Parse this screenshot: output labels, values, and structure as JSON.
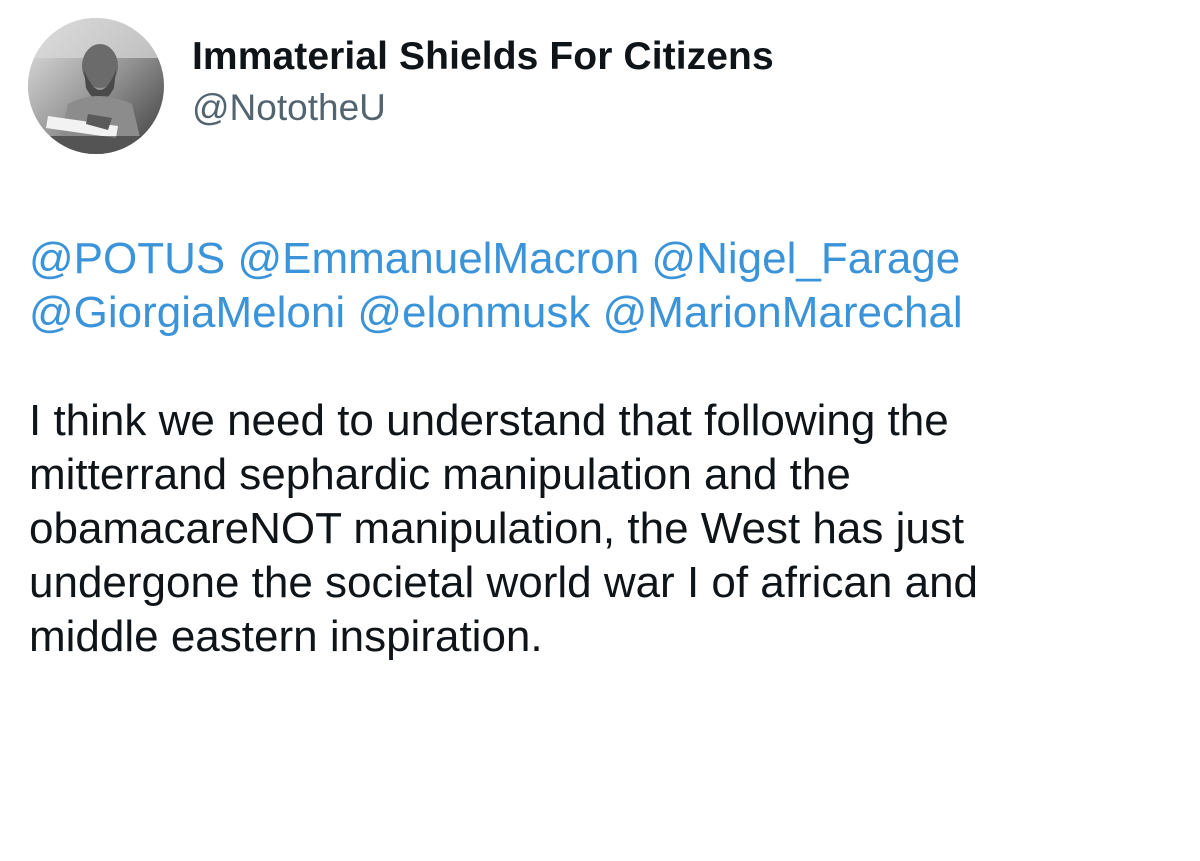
{
  "author": {
    "display_name": "Immaterial Shields For Citizens",
    "handle": "@NototheU",
    "avatar_icon": "profile-photo"
  },
  "tweet": {
    "mentions_line1": [
      "@POTUS",
      "@EmmanuelMacron",
      "@Nigel_Farage"
    ],
    "mentions_line2": [
      "@GiorgiaMeloni",
      "@elonmusk",
      "@MarionMarechal"
    ],
    "body_lines": [
      "I think we need to understand that following the",
      "mitterrand sephardic manipulation and the",
      "obamacareNOT manipulation, the West has just",
      "undergone the societal world war I of african and",
      "middle eastern inspiration."
    ]
  },
  "colors": {
    "mention": "#3b94d9",
    "text": "#0f1419",
    "handle": "#536471",
    "background": "#ffffff"
  }
}
